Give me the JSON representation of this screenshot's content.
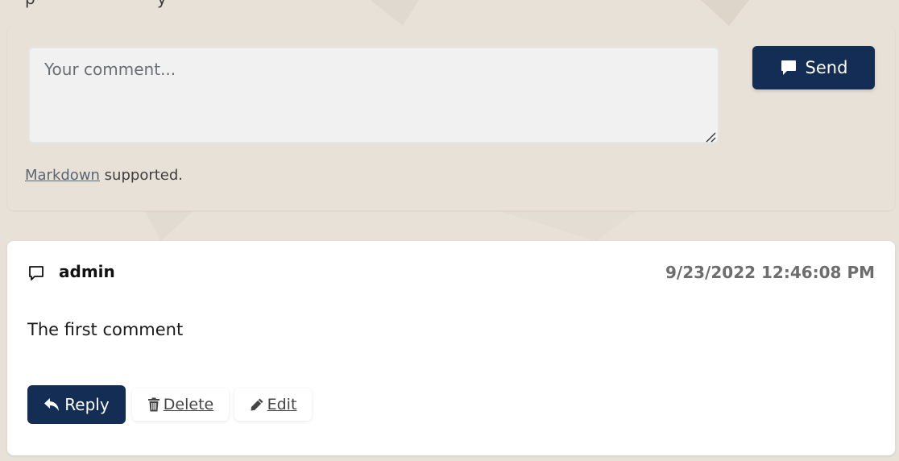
{
  "compose": {
    "placeholder": "Your comment...",
    "send_label": "Send",
    "markdown_link": "Markdown",
    "markdown_suffix": " supported."
  },
  "comment": {
    "author": "admin",
    "timestamp": "9/23/2022 12:46:08 PM",
    "body": "The first comment",
    "reply_label": "Reply",
    "delete_label": "Delete",
    "edit_label": "Edit"
  },
  "icons": {
    "send": "comment-solid-icon",
    "comment": "comment-outline-icon",
    "reply": "reply-arrow-icon",
    "delete": "trash-icon",
    "edit": "pencil-icon"
  },
  "colors": {
    "background": "#e7e1d8",
    "primary": "#132d55",
    "card": "#ffffff",
    "textarea_bg": "#f1f1f1"
  }
}
